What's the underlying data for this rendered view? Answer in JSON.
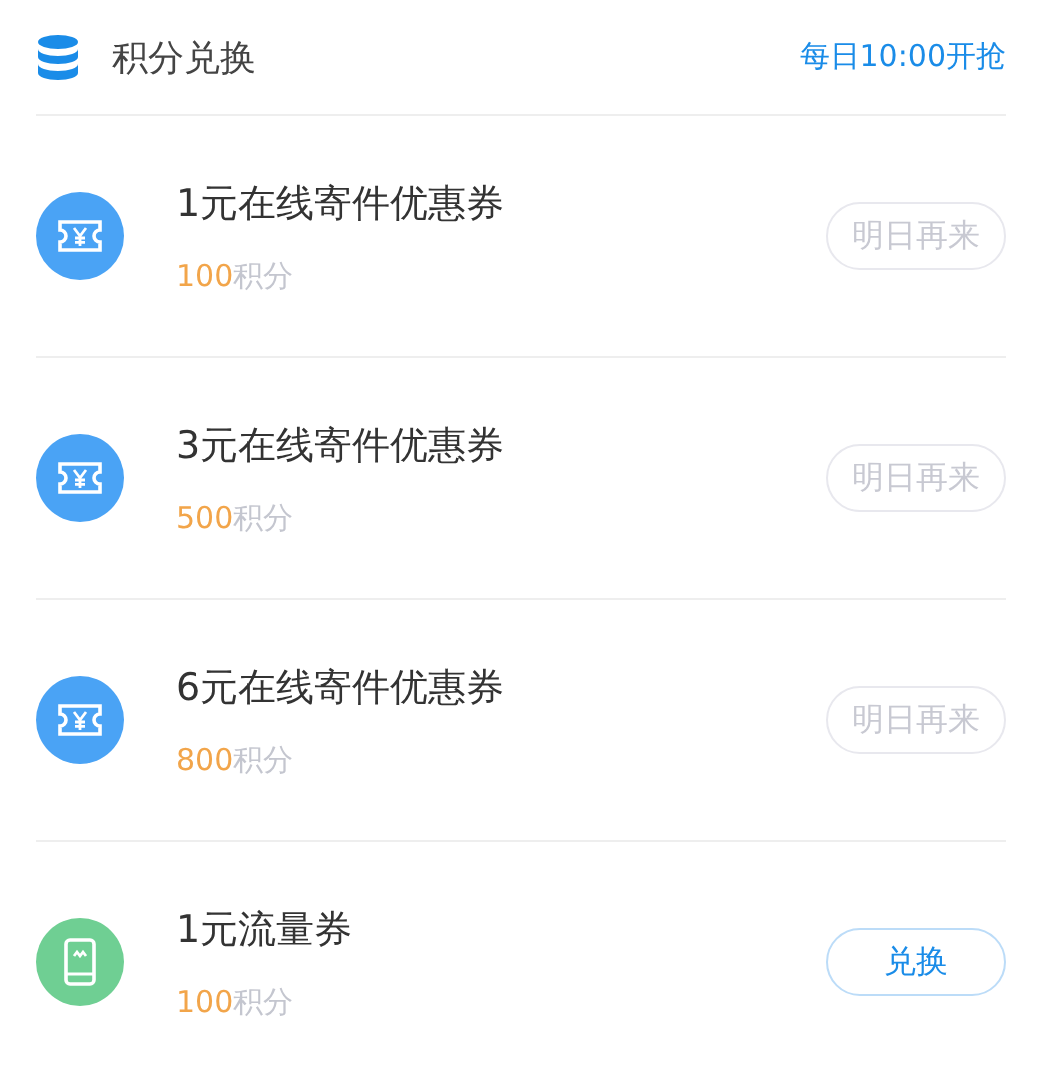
{
  "header": {
    "title": "积分兑换",
    "note": "每日10:00开抢"
  },
  "items": [
    {
      "kind": "ticket",
      "name": "1元在线寄件优惠券",
      "points": "100",
      "points_unit": "积分",
      "button": {
        "label": "明日再来",
        "disabled": true
      }
    },
    {
      "kind": "ticket",
      "name": "3元在线寄件优惠券",
      "points": "500",
      "points_unit": "积分",
      "button": {
        "label": "明日再来",
        "disabled": true
      }
    },
    {
      "kind": "ticket",
      "name": "6元在线寄件优惠券",
      "points": "800",
      "points_unit": "积分",
      "button": {
        "label": "明日再来",
        "disabled": true
      }
    },
    {
      "kind": "phone",
      "name": "1元流量券",
      "points": "100",
      "points_unit": "积分",
      "button": {
        "label": "兑换",
        "disabled": false
      }
    }
  ]
}
